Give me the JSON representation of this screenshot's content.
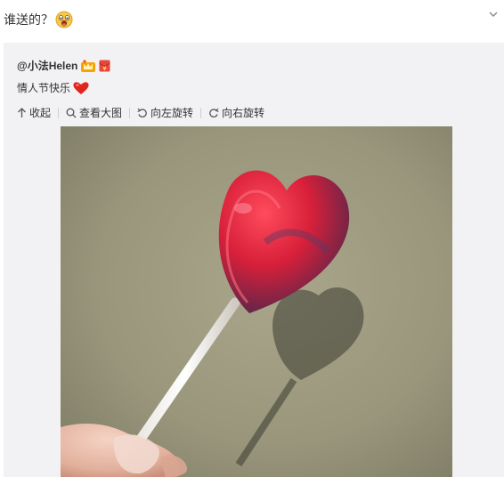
{
  "post": {
    "text": "谁送的？",
    "emoji_icon": "surprised-face-icon"
  },
  "repost": {
    "author": "@小法Helen",
    "badges": [
      "vip-crown-icon",
      "red-envelope-icon"
    ],
    "text": "情人节快乐",
    "text_icon": "heart-icon"
  },
  "toolbar": {
    "collapse_label": "收起",
    "view_large_label": "查看大图",
    "rotate_left_label": "向左旋转",
    "rotate_right_label": "向右旋转"
  },
  "colors": {
    "repost_background": "#f2f2f5",
    "text": "#333333"
  }
}
